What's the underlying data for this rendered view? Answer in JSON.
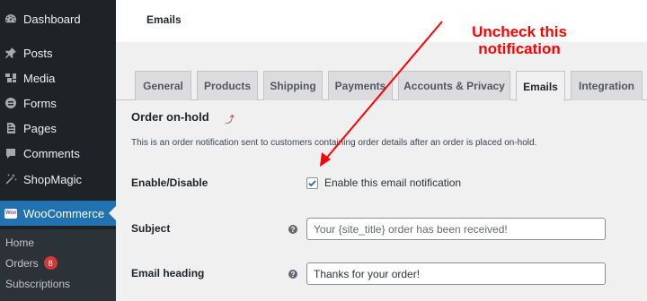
{
  "sidebar": {
    "items": [
      {
        "label": "Dashboard",
        "icon": "dashboard-icon"
      },
      {
        "label": "Posts",
        "icon": "pin-icon"
      },
      {
        "label": "Media",
        "icon": "media-icon"
      },
      {
        "label": "Forms",
        "icon": "forms-icon"
      },
      {
        "label": "Pages",
        "icon": "pages-icon"
      },
      {
        "label": "Comments",
        "icon": "comments-icon"
      },
      {
        "label": "ShopMagic",
        "icon": "magic-wand-icon"
      },
      {
        "label": "WooCommerce",
        "icon": "woocommerce-icon",
        "logo_text": "Woo"
      }
    ],
    "submenu": [
      {
        "label": "Home"
      },
      {
        "label": "Orders",
        "badge": "8"
      },
      {
        "label": "Subscriptions"
      }
    ]
  },
  "header": {
    "title": "Emails"
  },
  "tabs": [
    {
      "label": "General"
    },
    {
      "label": "Products"
    },
    {
      "label": "Shipping"
    },
    {
      "label": "Payments"
    },
    {
      "label": "Accounts & Privacy"
    },
    {
      "label": "Emails",
      "active": true
    },
    {
      "label": "Integration"
    }
  ],
  "section": {
    "title": "Order on-hold",
    "back_link_icon": "up-arrow-icon",
    "description": "This is an order notification sent to customers containing order details after an order is placed on-hold."
  },
  "form": {
    "enable": {
      "label": "Enable/Disable",
      "checkbox_label": "Enable this email notification",
      "checked": true
    },
    "subject": {
      "label": "Subject",
      "placeholder": "Your {site_title} order has been received!",
      "value": ""
    },
    "heading": {
      "label": "Email heading",
      "placeholder": "",
      "value": "Thanks for your order!"
    }
  },
  "annotation": {
    "text": "Uncheck this notification",
    "color": "#ff0000"
  },
  "colors": {
    "sidebar_bg": "#1d2327",
    "active": "#2271b1",
    "badge": "#d63638"
  }
}
